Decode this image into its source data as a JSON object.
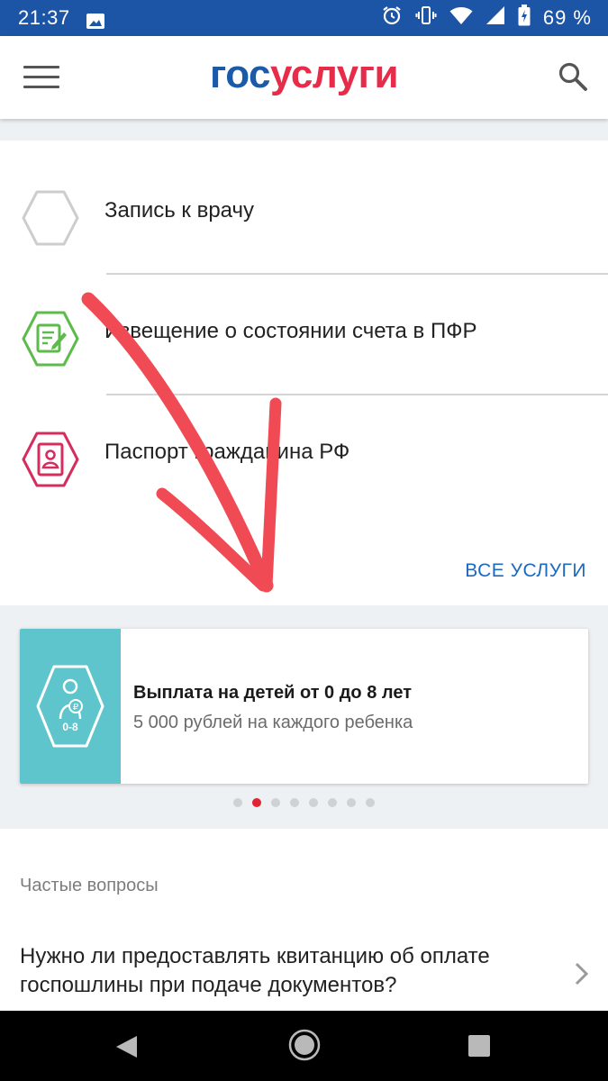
{
  "status_bar": {
    "time": "21:37",
    "battery": "69 %"
  },
  "header": {
    "logo_part1": "гос",
    "logo_part2": "услуги"
  },
  "services": [
    {
      "label": "Запись к врачу",
      "icon": "hexagon-outline-icon"
    },
    {
      "label": "Извещение о состоянии счета в ПФР",
      "icon": "document-edit-icon"
    },
    {
      "label": "Паспорт гражданина РФ",
      "icon": "passport-icon"
    }
  ],
  "all_services_link": "ВСЕ УСЛУГИ",
  "banner": {
    "title": "Выплата на детей от 0 до 8 лет",
    "subtitle": "5 000 рублей на каждого ребенка",
    "icon_text": "0-8",
    "icon_symbol": "₽"
  },
  "carousel": {
    "total": 8,
    "active_index": 1
  },
  "faq": {
    "heading": "Частые вопросы",
    "question": "Нужно ли предоставлять квитанцию об оплате госпошлины при подаче документов?"
  },
  "colors": {
    "status_bar": "#1c55a5",
    "logo_blue": "#1b5aa8",
    "logo_red": "#e62c48",
    "link": "#1b6ac0",
    "banner_block": "#5ec5cc",
    "dot_active": "#e02432",
    "annotation_arrow": "#f04a55"
  }
}
